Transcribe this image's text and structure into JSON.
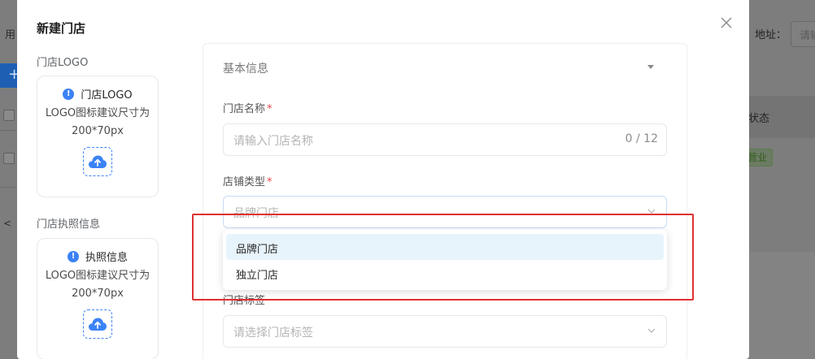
{
  "background": {
    "left_text": "用",
    "add_button_label": "+",
    "pager_text": "<",
    "address_label": "地址：",
    "address_placeholder": "请输",
    "status_header": "状态",
    "status_tag": "营业"
  },
  "modal": {
    "title": "新建门店",
    "close_icon": "close-icon",
    "logo_section": {
      "label": "门店LOGO",
      "card_title": "门店LOGO",
      "hint": "LOGO图标建议尺寸为200*70px",
      "icon": "cloud-upload-icon"
    },
    "license_section": {
      "label": "门店执照信息",
      "card_title": "执照信息",
      "hint": "LOGO图标建议尺寸为200*70px",
      "icon": "cloud-upload-icon"
    },
    "form": {
      "section_title": "基本信息",
      "store_name": {
        "label": "门店名称",
        "required_mark": "*",
        "placeholder": "请输入门店名称",
        "counter": "0 / 12"
      },
      "store_type": {
        "label": "店铺类型",
        "required_mark": "*",
        "value": "品牌门店",
        "options": [
          "品牌门店",
          "独立门店"
        ],
        "selected_index": 0
      },
      "store_tag": {
        "label": "门店标签",
        "placeholder": "请选择门店标签"
      }
    }
  },
  "colors": {
    "accent": "#3b82f6",
    "highlight": "#e03030",
    "selected_option_bg": "#e8f4fc"
  }
}
